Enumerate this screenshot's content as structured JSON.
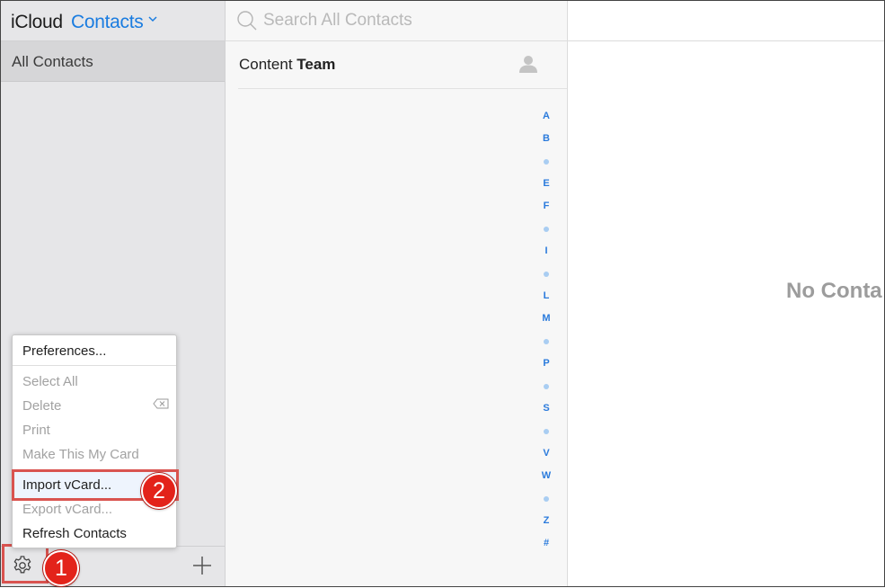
{
  "header": {
    "brand": "iCloud",
    "app_name": "Contacts"
  },
  "sidebar": {
    "group": "All Contacts"
  },
  "search": {
    "placeholder": "Search All Contacts",
    "value": ""
  },
  "contact": {
    "first": "Content ",
    "last": "Team"
  },
  "index_letters": [
    "A",
    "B",
    "•",
    "E",
    "F",
    "•",
    "I",
    "•",
    "L",
    "M",
    "•",
    "P",
    "•",
    "S",
    "•",
    "V",
    "W",
    "•",
    "Z",
    "#"
  ],
  "menu": {
    "items": [
      {
        "label": "Preferences...",
        "enabled": true
      },
      {
        "label": "Select All",
        "enabled": false
      },
      {
        "label": "Delete",
        "enabled": false
      },
      {
        "label": "Print",
        "enabled": false
      },
      {
        "label": "Make This My Card",
        "enabled": false
      },
      {
        "label": "Import vCard...",
        "enabled": true,
        "highlighted": true
      },
      {
        "label": "Export vCard...",
        "enabled": false
      },
      {
        "label": "Refresh Contacts",
        "enabled": true
      }
    ]
  },
  "annotations": {
    "step1": "1",
    "step2": "2"
  },
  "detail": {
    "empty_text": "No Conta"
  },
  "colors": {
    "accent": "#1a7ce0",
    "annotation": "#e3231a",
    "index_letter": "#2b7bdc"
  },
  "icons": {
    "gear": "gear-icon",
    "add": "plus-icon",
    "search": "search-icon",
    "person": "person-icon",
    "delete": "delete-key-icon",
    "chevron": "chevron-down-icon"
  }
}
